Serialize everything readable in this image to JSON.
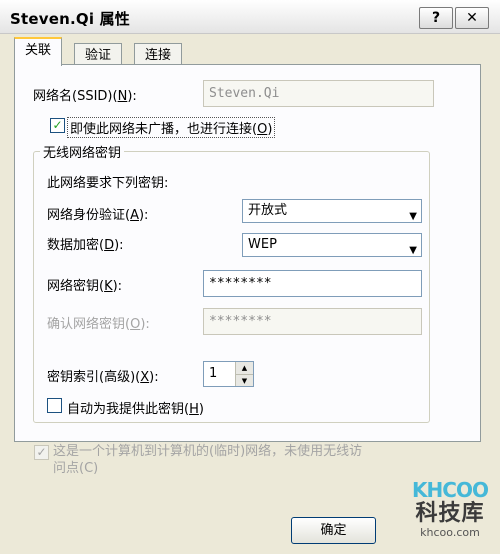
{
  "window": {
    "title": "Steven.Qi 属性",
    "help_glyph": "?",
    "close_glyph": "✕"
  },
  "tabs": [
    {
      "label": "关联",
      "active": true
    },
    {
      "label": "验证",
      "active": false
    },
    {
      "label": "连接",
      "active": false
    }
  ],
  "network_name": {
    "label": "网络名(SSID)(",
    "key": "N",
    "suffix": "):",
    "value": "Steven.Qi"
  },
  "broadcast_checkbox": {
    "label": "即使此网络未广播，也进行连接(",
    "key": "O",
    "suffix": ")",
    "checked": true
  },
  "key_group": {
    "title": "无线网络密钥",
    "intro": "此网络要求下列密钥:",
    "auth": {
      "label": "网络身份验证(",
      "key": "A",
      "suffix": "):",
      "value": "开放式"
    },
    "encryption": {
      "label": "数据加密(",
      "key": "D",
      "suffix": "):",
      "value": "WEP"
    },
    "network_key": {
      "label": "网络密钥(",
      "key": "K",
      "suffix": "):",
      "value": "********"
    },
    "confirm_key": {
      "label": "确认网络密钥(",
      "key": "O",
      "suffix": "):",
      "value": "********"
    },
    "key_index": {
      "label": "密钥索引(高级)(",
      "key": "X",
      "suffix": "):",
      "value": "1"
    },
    "auto_key": {
      "label": "自动为我提供此密钥(",
      "key": "H",
      "suffix": ")",
      "checked": false
    }
  },
  "adhoc_checkbox": {
    "line1": "这是一个计算机到计算机的(临时)网络，未使用无线访",
    "line2": "问点(C)",
    "checked": true,
    "disabled": true
  },
  "ok_label": "确定",
  "watermark": {
    "logo": "KHCOO",
    "name": "科技库",
    "url": "khcoo.com"
  },
  "colors": {
    "titlebar": "#ffffff",
    "dialog_bg": "#ECE9D8",
    "active_tab_accent": "#ffc83c",
    "check_green": "#21a121"
  }
}
